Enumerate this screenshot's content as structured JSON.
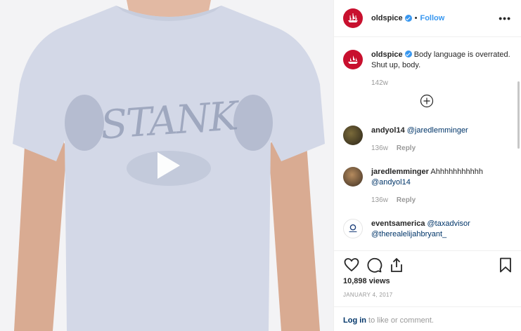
{
  "post": {
    "username": "oldspice",
    "follow_label": "Follow",
    "dot": "•",
    "more": "•••"
  },
  "caption": {
    "username": "oldspice",
    "text": "Body language is overrated. Shut up, body.",
    "time": "142w"
  },
  "comments": [
    {
      "username": "andyol14",
      "mention": "@jaredlemminger",
      "text": "",
      "time": "136w",
      "reply": "Reply"
    },
    {
      "username": "jaredlemminger",
      "text": "Ahhhhhhhhhhh",
      "mention": "@andyol14",
      "time": "136w",
      "reply": "Reply"
    },
    {
      "username": "eventsamerica",
      "mention": "@taxadvisor",
      "mention2": "@therealelijahbryant_"
    }
  ],
  "stats": {
    "views": "10,898 views",
    "date": "JANUARY 4, 2017"
  },
  "login": {
    "link": "Log in",
    "text": " to like or comment."
  },
  "media": {
    "shirt_text": "STANK"
  },
  "colors": {
    "brand": "#c8102e",
    "link": "#3897f0",
    "mention": "#003569"
  }
}
